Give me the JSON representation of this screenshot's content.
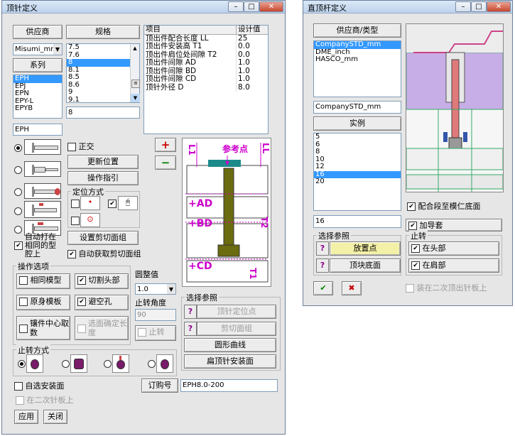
{
  "left": {
    "title": "顶针定义",
    "supplier_btn": "供应商",
    "spec_btn": "规格",
    "supplier_select": "Misumi_mm",
    "series_btn": "系列",
    "series_items": [
      "EPH",
      "EPJ",
      "EPN",
      "EPY-L",
      "EPYB"
    ],
    "series_value": "EPH",
    "spec_items": [
      "7.5",
      "7.6",
      "8",
      "8.1",
      "8.5",
      "8.6",
      "9",
      "9.1"
    ],
    "spec_value": "8",
    "props_header": [
      "项目",
      "设计值"
    ],
    "props_rows": [
      [
        "顶出件配合长度 LL",
        "25"
      ],
      [
        "顶出件安装高 T1",
        "0.0"
      ],
      [
        "顶出件肩位处间隙 T2",
        "0.0"
      ],
      [
        "顶出件间隙 AD",
        "1.0"
      ],
      [
        "顶出件间隙 BD",
        "1.0"
      ],
      [
        "顶出件间隙 CD",
        "1.0"
      ],
      [
        "顶针外径 D",
        "8.0"
      ]
    ],
    "orthogonal_label": "正交",
    "update_pos_btn": "更新位置",
    "guide_btn": "操作指引",
    "locate_group": "定位方式",
    "set_cut_group_btn": "设置剪切面组",
    "auto_get_cut_label": "自动获取剪切面组",
    "auto_hit_label": "自动打在相同的型腔上",
    "plus_label": "+",
    "minus_label": "−",
    "diagram": {
      "ref_point": "参考点",
      "l1": "L1",
      "ll": "LL",
      "ad": "+AD",
      "bd": "+BD",
      "cd": "+CD",
      "t1": "T1",
      "t2": "T2"
    },
    "ops_group": "操作选项",
    "same_model_label": "相同模型",
    "cut_head_label": "切割头部",
    "original_plate_label": "原身模板",
    "avoid_hole_label": "避空孔",
    "part_center_label": "镶件中心取数",
    "select_length_label": "选面确定长度",
    "round_label": "圆整值",
    "round_value": "1.0",
    "rot_angle_label": "止转角度",
    "rot_angle_value": "90",
    "rot_check_label": "止转",
    "rot_group": "止转方式",
    "select_ref_group": "选择参照",
    "ref_pos_btn": "顶针定位点",
    "cut_group_btn": "剪切面组",
    "round_curve_btn": "圆形曲线",
    "flat_face_btn": "扁顶针安装面",
    "self_install_label": "自选安装面",
    "order_btn": "订购号",
    "order_value": "EPH8.0-200",
    "second_plate_label": "在二次针板上",
    "apply_btn": "应用",
    "close_btn": "关闭"
  },
  "right": {
    "title": "直顶杆定义",
    "supplier_btn": "供应商/类型",
    "supplier_items": [
      "CompanySTD_mm",
      "DME_inch",
      "HASCO_mm"
    ],
    "supplier_value": "CompanySTD_mm",
    "example_btn": "实例",
    "size_items": [
      "5",
      "6",
      "8",
      "10",
      "12",
      "16",
      "20"
    ],
    "size_value": "16",
    "fit_bottom_label": "配合段至模仁底面",
    "guide_sleeve_label": "加导套",
    "select_ref_group": "选择参照",
    "place_point_btn": "放置点",
    "top_bottom_btn": "顶块底面",
    "rot_group": "止转",
    "at_head_label": "在头部",
    "at_shoulder_label": "在肩部",
    "second_plate_label": "装在二次顶出针板上",
    "ok_symbol": "✔",
    "cancel_symbol": "✖"
  },
  "colors": {
    "selection": "#3399ff",
    "diagram_magenta": "#cc00cc",
    "diagram_olive": "#6b6b10",
    "diagram_teal": "#1c8a8a",
    "red": "#cc0000",
    "green": "#008000",
    "preview_purple": "#c8aee6"
  }
}
